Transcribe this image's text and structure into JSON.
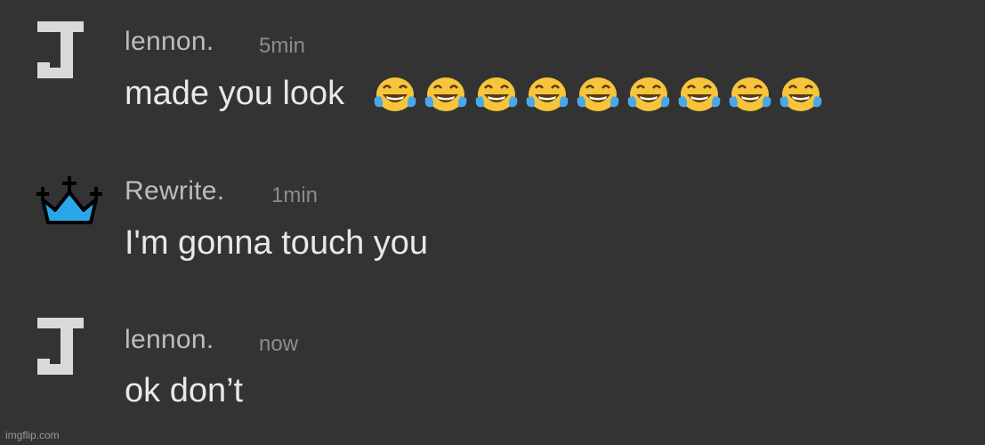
{
  "colors": {
    "background": "#333333",
    "username": "#bdbdbd",
    "timestamp": "#8c8c8c",
    "message": "#e8e8e8",
    "crown": "#2aa7e8"
  },
  "messages": [
    {
      "avatar_icon": "letter-j-avatar-icon",
      "username": "lennon.",
      "time": "5min",
      "text": "made you look",
      "emoji": "face-with-tears-of-joy-icon",
      "emoji_count": 9
    },
    {
      "avatar_icon": "crown-avatar-icon",
      "username": "Rewrite.",
      "time": "1min",
      "text": "I'm gonna touch you"
    },
    {
      "avatar_icon": "letter-j-avatar-icon",
      "username": "lennon.",
      "time": "now",
      "text": "ok don’t"
    }
  ],
  "watermark": "imgflip.com"
}
